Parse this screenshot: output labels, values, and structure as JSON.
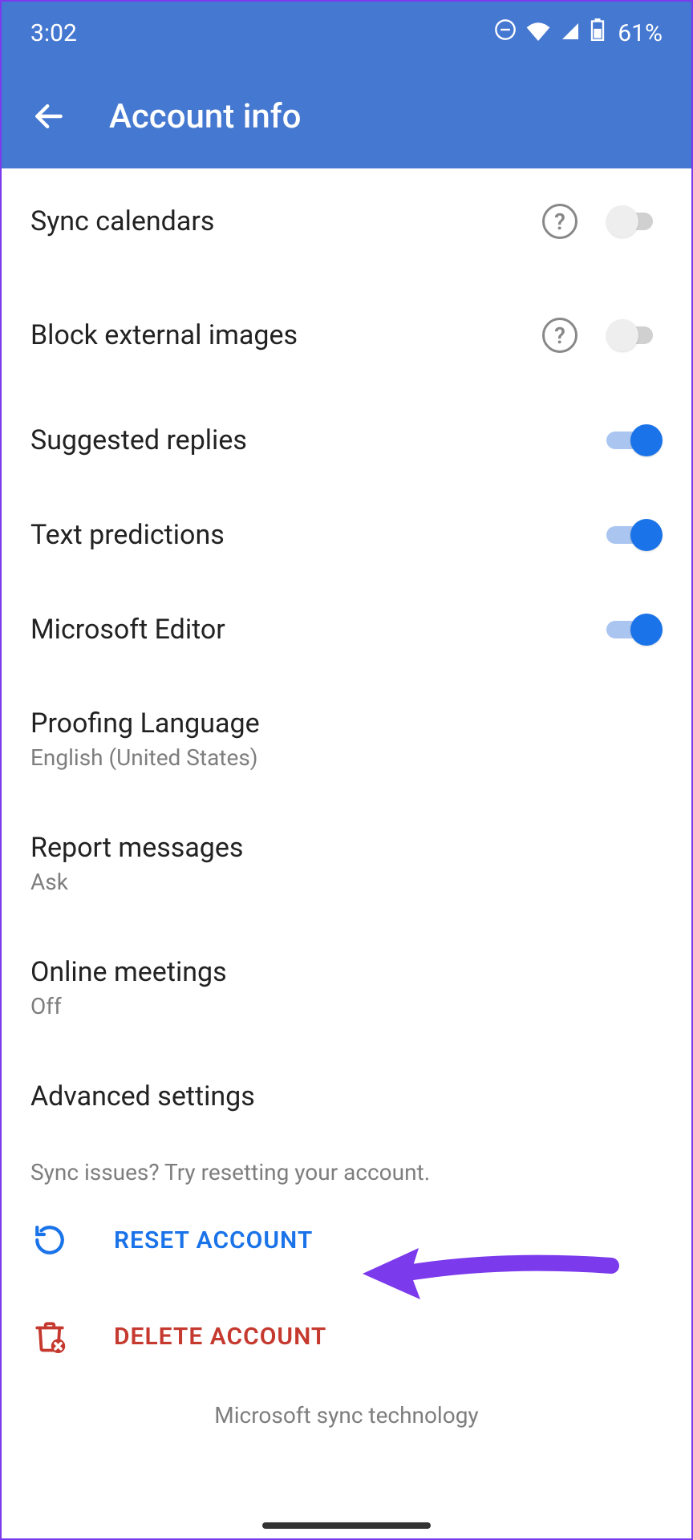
{
  "statusbar": {
    "time": "3:02",
    "batteryPercent": "61%"
  },
  "appbar": {
    "title": "Account info"
  },
  "settings": {
    "syncCalendars": {
      "label": "Sync calendars",
      "on": false,
      "help": true
    },
    "blockExternalImages": {
      "label": "Block external images",
      "on": false,
      "help": true
    },
    "suggestedReplies": {
      "label": "Suggested replies",
      "on": true
    },
    "textPredictions": {
      "label": "Text predictions",
      "on": true
    },
    "microsoftEditor": {
      "label": "Microsoft Editor",
      "on": true
    },
    "proofingLanguage": {
      "label": "Proofing Language",
      "value": "English (United States)"
    },
    "reportMessages": {
      "label": "Report messages",
      "value": "Ask"
    },
    "onlineMeetings": {
      "label": "Online meetings",
      "value": "Off"
    },
    "advancedSettings": {
      "label": "Advanced settings"
    }
  },
  "hint": "Sync issues? Try resetting your account.",
  "actions": {
    "reset": "RESET ACCOUNT",
    "delete": "DELETE ACCOUNT"
  },
  "footer": "Microsoft sync technology",
  "colors": {
    "accent": "#1a73e8",
    "headerBg": "#4578d0",
    "danger": "#c5392e",
    "annotation": "#7c3aed"
  }
}
